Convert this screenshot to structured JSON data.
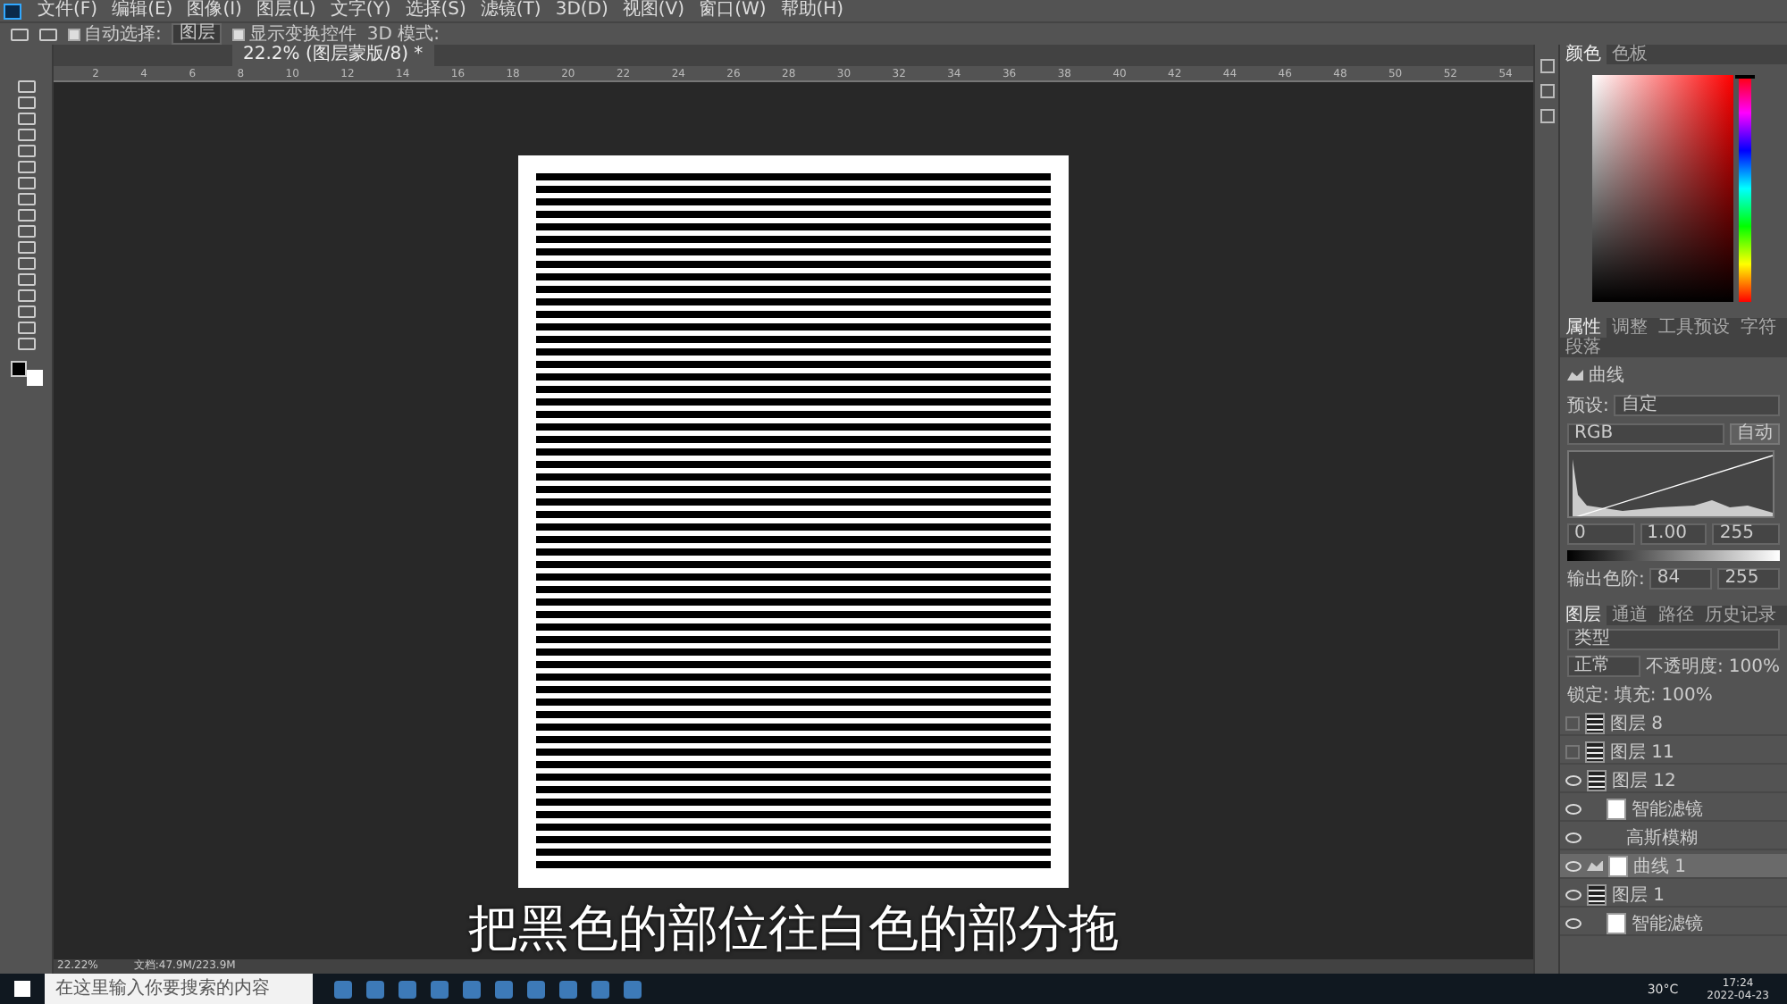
{
  "menu": [
    "文件(F)",
    "编辑(E)",
    "图像(I)",
    "图层(L)",
    "文字(Y)",
    "选择(S)",
    "滤镜(T)",
    "3D(D)",
    "视图(V)",
    "窗口(W)",
    "帮助(H)"
  ],
  "options": {
    "auto_select": {
      "label": "自动选择:",
      "checked": true
    },
    "target": "图层",
    "show_transform": {
      "label": "显示变换控件",
      "checked": true
    },
    "mode_3d": "3D 模式:"
  },
  "document_tab": {
    "title": "22.2% (图层蒙版/8) *",
    "selected": true
  },
  "ruler": [
    "2",
    "4",
    "6",
    "8",
    "10",
    "12",
    "14",
    "16",
    "18",
    "20",
    "22",
    "24",
    "26",
    "28",
    "30",
    "32",
    "34",
    "36",
    "38",
    "40",
    "42",
    "44",
    "46",
    "48",
    "50",
    "52",
    "54"
  ],
  "subtitle": "把黑色的部位往白色的部分拖",
  "status_bar": {
    "zoom": "22.22%",
    "doc": "文档:47.9M/223.9M"
  },
  "color_panel": {
    "tabs": [
      {
        "label": "颜色",
        "selected": true
      },
      {
        "label": "色板",
        "selected": false
      }
    ],
    "hue_slider": {
      "level": 0
    }
  },
  "properties": {
    "tabs": [
      {
        "label": "属性",
        "selected": true
      },
      {
        "label": "调整",
        "selected": false
      },
      {
        "label": "工具预设",
        "selected": false
      },
      {
        "label": "字符",
        "selected": false
      },
      {
        "label": "段落",
        "selected": false
      }
    ],
    "title": "曲线",
    "preset_label": "预设:",
    "preset": "自定",
    "channel": "RGB",
    "auto": "自动",
    "input": [
      "0",
      "1.00",
      "255"
    ],
    "output_label": "输出色阶:",
    "output": [
      "84",
      "255"
    ]
  },
  "layers": {
    "tabs": [
      {
        "label": "图层",
        "selected": true
      },
      {
        "label": "通道",
        "selected": false
      },
      {
        "label": "路径",
        "selected": false
      },
      {
        "label": "历史记录",
        "selected": false
      }
    ],
    "filter": "类型",
    "blend": "正常",
    "opacity_label": "不透明度:",
    "opacity": "100%",
    "lock_label": "锁定:",
    "fill_label": "填充:",
    "fill": "100%",
    "items": [
      {
        "kind": "layer",
        "name": "图层 8",
        "visible": false,
        "selected": false
      },
      {
        "kind": "layer",
        "name": "图层 11",
        "visible": false,
        "selected": false
      },
      {
        "kind": "layer",
        "name": "图层 12",
        "visible": true,
        "selected": false
      },
      {
        "kind": "filter",
        "name": "智能滤镜",
        "visible": true,
        "selected": false
      },
      {
        "kind": "effect",
        "name": "高斯模糊",
        "visible": true,
        "selected": false
      },
      {
        "kind": "adjustment",
        "name": "曲线 1",
        "visible": true,
        "selected": true
      },
      {
        "kind": "layer",
        "name": "图层 1",
        "visible": true,
        "selected": false
      },
      {
        "kind": "filter",
        "name": "智能滤镜",
        "visible": true,
        "selected": false
      }
    ]
  },
  "taskbar": {
    "search_placeholder": "在这里输入你要搜索的内容",
    "weather": "30°C",
    "time": "17:24",
    "date": "2022-04-23"
  }
}
